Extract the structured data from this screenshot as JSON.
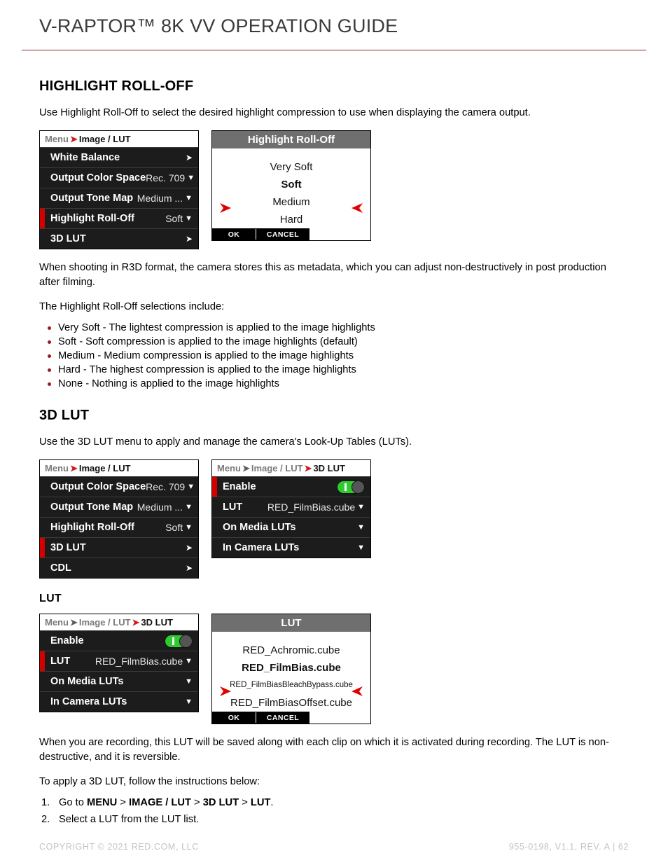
{
  "header": {
    "title": "V-RAPTOR™ 8K VV OPERATION GUIDE"
  },
  "highlight_rolloff": {
    "heading": "HIGHLIGHT ROLL-OFF",
    "intro": "Use Highlight Roll-Off to select the desired highlight compression to use when displaying the camera output.",
    "menu": {
      "breadcrumb": {
        "root": "Menu",
        "sep": "➤",
        "current": "Image / LUT"
      },
      "rows": [
        {
          "label": "White Balance",
          "value": "",
          "control": "arrow",
          "selected": false
        },
        {
          "label": "Output Color Space",
          "value": "Rec. 709",
          "control": "caret",
          "selected": false
        },
        {
          "label": "Output Tone Map",
          "value": "Medium ...",
          "control": "caret",
          "selected": false
        },
        {
          "label": "Highlight Roll-Off",
          "value": "Soft",
          "control": "caret",
          "selected": true
        },
        {
          "label": "3D LUT",
          "value": "",
          "control": "arrow",
          "selected": false
        }
      ]
    },
    "dialog": {
      "title": "Highlight Roll-Off",
      "options": [
        {
          "label": "Very Soft",
          "selected": false,
          "small": false
        },
        {
          "label": "Soft",
          "selected": true,
          "small": false
        },
        {
          "label": "Medium",
          "selected": false,
          "small": false
        },
        {
          "label": "Hard",
          "selected": false,
          "small": false
        }
      ],
      "ok_label": "OK",
      "cancel_label": "CANCEL"
    },
    "note": "When shooting in R3D format, the camera stores this as metadata, which you can adjust non-destructively in post production after filming.",
    "list_intro": "The Highlight Roll-Off selections include:",
    "bullets": [
      "Very Soft - The lightest compression is applied to the image highlights",
      "Soft - Soft compression is applied to the image highlights (default)",
      "Medium - Medium compression is applied to the image highlights",
      "Hard - The highest compression is applied to the image highlights",
      "None - Nothing is applied to the image highlights"
    ]
  },
  "three_d_lut": {
    "heading": "3D LUT",
    "intro": "Use the 3D LUT menu to apply and manage the camera's Look-Up Tables (LUTs).",
    "menu_left": {
      "breadcrumb": {
        "root": "Menu",
        "sep": "➤",
        "current": "Image / LUT"
      },
      "rows": [
        {
          "label": "Output Color Space",
          "value": "Rec. 709",
          "control": "caret",
          "selected": false
        },
        {
          "label": "Output Tone Map",
          "value": "Medium ...",
          "control": "caret",
          "selected": false
        },
        {
          "label": "Highlight Roll-Off",
          "value": "Soft",
          "control": "caret",
          "selected": false
        },
        {
          "label": "3D LUT",
          "value": "",
          "control": "arrow",
          "selected": true
        },
        {
          "label": "CDL",
          "value": "",
          "control": "arrow",
          "selected": false
        }
      ]
    },
    "menu_right": {
      "breadcrumb": {
        "root": "Menu",
        "sep": "➤",
        "mid": "Image / LUT",
        "current": "3D LUT"
      },
      "rows": [
        {
          "label": "Enable",
          "value": "",
          "control": "toggle",
          "toggle_on": true,
          "selected": true
        },
        {
          "label": "LUT",
          "value": "RED_FilmBias.cube",
          "control": "caret",
          "selected": false
        },
        {
          "label": "On Media LUTs",
          "value": "",
          "control": "caret",
          "selected": false
        },
        {
          "label": "In Camera LUTs",
          "value": "",
          "control": "caret",
          "selected": false
        }
      ]
    }
  },
  "lut": {
    "heading": "LUT",
    "menu": {
      "breadcrumb": {
        "root": "Menu",
        "sep": "➤",
        "mid": "Image / LUT",
        "current": "3D LUT"
      },
      "rows": [
        {
          "label": "Enable",
          "value": "",
          "control": "toggle",
          "toggle_on": true,
          "selected": false
        },
        {
          "label": "LUT",
          "value": "RED_FilmBias.cube",
          "control": "caret",
          "selected": true
        },
        {
          "label": "On Media LUTs",
          "value": "",
          "control": "caret",
          "selected": false
        },
        {
          "label": "In Camera LUTs",
          "value": "",
          "control": "caret",
          "selected": false
        }
      ]
    },
    "dialog": {
      "title": "LUT",
      "options": [
        {
          "label": "RED_Achromic.cube",
          "selected": false,
          "small": false
        },
        {
          "label": "RED_FilmBias.cube",
          "selected": true,
          "small": false
        },
        {
          "label": "RED_FilmBiasBleachBypass.cube",
          "selected": false,
          "small": true
        },
        {
          "label": "RED_FilmBiasOffset.cube",
          "selected": false,
          "small": false
        }
      ],
      "ok_label": "OK",
      "cancel_label": "CANCEL"
    },
    "note": "When you are recording, this LUT will be saved along with each clip on which it is activated during recording. The LUT is non-destructive, and it is reversible.",
    "steps_intro": "To apply a 3D LUT, follow the instructions below:",
    "steps": [
      {
        "prefix": "Go to ",
        "parts": [
          "MENU",
          "IMAGE / LUT",
          "3D LUT",
          "LUT"
        ],
        "separator": " > ",
        "suffix": "."
      },
      {
        "plain": "Select a LUT from the LUT list."
      }
    ]
  },
  "footer": {
    "copyright": "COPYRIGHT © 2021 RED.COM, LLC",
    "docinfo": "955-0198, V1.1, REV. A  |  62"
  },
  "colors": {
    "accent_red": "#d40000",
    "rule_red": "#8c2230",
    "bullet_red": "#9a1b24",
    "toggle_green": "#2ecb2e",
    "menu_bg": "#1c1c1c",
    "dialog_title_gray": "#6f6f6f"
  }
}
